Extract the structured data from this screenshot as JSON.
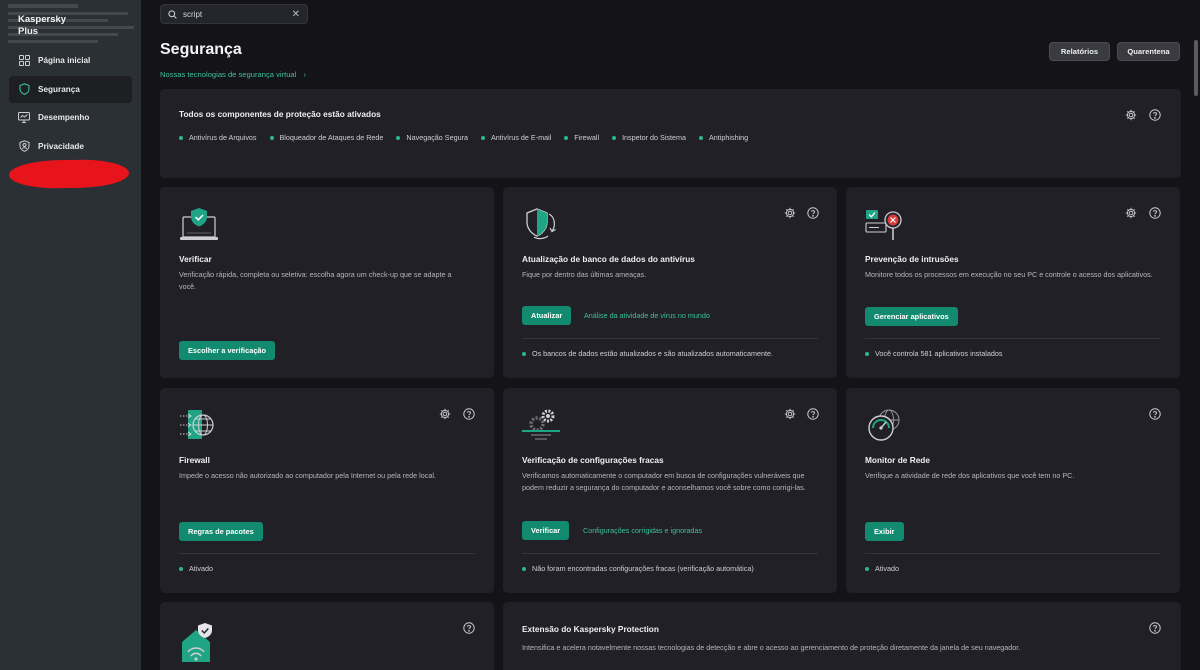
{
  "app": {
    "name_line1": "Kaspersky",
    "name_line2": "Plus"
  },
  "sidebar": {
    "items": [
      {
        "label": "Página inicial",
        "icon": "home-grid-icon"
      },
      {
        "label": "Segurança",
        "icon": "shield-icon"
      },
      {
        "label": "Desempenho",
        "icon": "performance-monitor-icon"
      },
      {
        "label": "Privacidade",
        "icon": "privacy-user-icon"
      }
    ]
  },
  "search": {
    "value": "script"
  },
  "header": {
    "title": "Segurança",
    "subtitle_link": "Nossas tecnologias de segurança virtual",
    "reports_button": "Relatórios",
    "quarantine_button": "Quarentena"
  },
  "components": {
    "title": "Todos os componentes de proteção estão ativados",
    "items": [
      "Antivírus de Arquivos",
      "Bloqueador de Ataques de Rede",
      "Navegação Segura",
      "Antivírus de E-mail",
      "Firewall",
      "Inspetor do Sistema",
      "Antiphishing"
    ]
  },
  "cards": {
    "scan": {
      "title": "Verificar",
      "desc": "Verificação rápida, completa ou seletiva: escolha agora um check-up que se adapte a você.",
      "button": "Escolher a verificação"
    },
    "update": {
      "title": "Atualização de banco de dados do antivírus",
      "desc": "Fique por dentro das últimas ameaças.",
      "button": "Atualizar",
      "link": "Análise da atividade de vírus no mundo",
      "status": "Os bancos de dados estão atualizados e são atualizados automaticamente."
    },
    "intrusion": {
      "title": "Prevenção de intrusões",
      "desc": "Monitore todos os processos em execução no seu PC e controle o acesso dos aplicativos.",
      "button": "Gerenciar aplicativos",
      "status": "Você controla 581 aplicativos instalados"
    },
    "firewall": {
      "title": "Firewall",
      "desc": "Impede o acesso não autorizado ao computador pela Internet ou pela rede local.",
      "button": "Regras de pacotes",
      "status": "Ativado"
    },
    "weak": {
      "title": "Verificação de configurações fracas",
      "desc": "Verificamos automaticamente o computador em busca de configurações vulneráveis que podem reduzir a segurança do computador e aconselhamos você sobre como corrigi-las.",
      "button": "Verificar",
      "link": "Configurações corrigidas e ignoradas",
      "status": "Não foram encontradas configurações fracas (verificação automática)"
    },
    "netmon": {
      "title": "Monitor de Rede",
      "desc": "Verifique a atividade de rede dos aplicativos que você tem no PC.",
      "button": "Exibir",
      "status": "Ativado"
    },
    "extension": {
      "title": "Extensão do Kaspersky Protection",
      "desc": "Intensifica e acelera notavelmente nossas tecnologias de detecção e abre o acesso ao gerenciamento de proteção diretamente da janela de seu navegador."
    }
  },
  "colors": {
    "accent": "#128a6f",
    "link": "#3ec0a0",
    "card": "#202026",
    "sidebar": "#2b3034",
    "status_dot": "#2bb591"
  }
}
